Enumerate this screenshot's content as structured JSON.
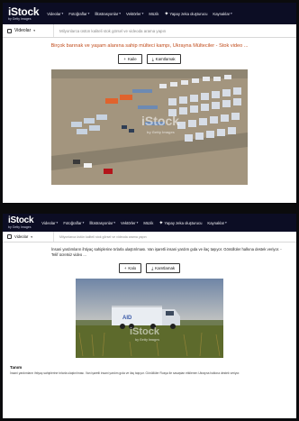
{
  "panel1": {
    "nav": {
      "logo": "iStock",
      "logo_sub": "by Getty Images",
      "items": [
        "Videolar",
        "Fotoğraflar",
        "İllüstrasyonlar",
        "Vektörler",
        "Müzik",
        "Yapay zeka oluşturucu",
        "Kaynaklar"
      ]
    },
    "search": {
      "type_label": "Videolar",
      "placeholder": "Milyonlarca üstün kaliteli stok görsel ve videoda arama yapın"
    },
    "title": "Birçok barınak ve yaşam alanına sahip mülteci kampı, Ukrayna Mülteciler - Stok video ...",
    "add_button": "Kaile",
    "download_button": "Kamtlamak",
    "watermark": "iStock",
    "watermark_sub": "by Getty Images"
  },
  "panel2": {
    "nav": {
      "logo": "iStock",
      "logo_sub": "by Getty Images",
      "items": [
        "Videolar",
        "Fotoğraflar",
        "İllüstrasyonlar",
        "Vektörler",
        "Müzik",
        "Yapay zeka oluşturucu",
        "Kaynaklar"
      ]
    },
    "search": {
      "type_label": "Videolar",
      "placeholder": "Milyonlarca üstün kaliteli stok görsel ve videoda arama yapın"
    },
    "caption": "İnsani yardımların ihtiyaç sahiplerine tırlarla ulaştırılması. Van işaretli insani yardım gıda ve ilaç taşıyor. Gönüllüler halkına destek veriyor. - Telif ücretsiz video ...",
    "add_button": "Kalo",
    "download_button": "Kamtlamak",
    "truck_label": "AID",
    "watermark": "iStock",
    "watermark_sub": "by Getty Images",
    "desc_title": "Tanım",
    "desc_body": "İnsani yardımların ihtiyaç sahiplerine tırlarla ulaştırılması. Van işaretli insani yardım gıda ve ilaç taşıyor. Gönüllüler Rusya ile savaştan etkilenen Ukrayna halkına destek veriyor."
  }
}
